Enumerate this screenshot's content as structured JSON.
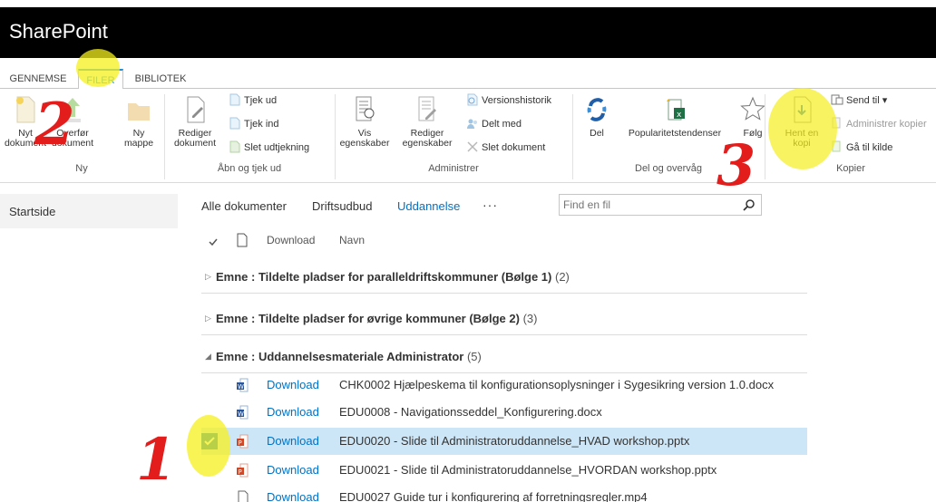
{
  "app": {
    "title": "SharePoint"
  },
  "ribbon_tabs": [
    {
      "label": "GENNEMSE",
      "active": false
    },
    {
      "label": "FILER",
      "active": true
    },
    {
      "label": "BIBLIOTEK",
      "active": false
    }
  ],
  "ribbon": {
    "ny": {
      "label": "Ny",
      "nyt_dokument": "Nyt\ndokument",
      "overfor_dokument": "Overfør\ndokument",
      "ny_mappe": "Ny\nmappe"
    },
    "aabn": {
      "label": "Åbn og tjek ud",
      "rediger_dokument": "Rediger\ndokument",
      "tjek_ud": "Tjek ud",
      "tjek_ind": "Tjek ind",
      "slet_udtjekning": "Slet udtjekning"
    },
    "administrer": {
      "label": "Administrer",
      "vis_egenskaber": "Vis\negenskaber",
      "rediger_egenskaber": "Rediger\negenskaber",
      "versionshistorik": "Versionshistorik",
      "delt_med": "Delt med",
      "slet_dokument": "Slet dokument"
    },
    "del": {
      "label": "Del og overvåg",
      "del": "Del",
      "popularitet": "Popularitetstendenser",
      "folg": "Følg"
    },
    "kopier": {
      "label": "Kopier",
      "hent_kopi": "Hent en\nkopi",
      "send_til": "Send til ▾",
      "administrer_kopier": "Administrer kopier",
      "gaa_til_kilde": "Gå til kilde"
    }
  },
  "leftnav": {
    "startside": "Startside"
  },
  "views": {
    "alle": "Alle dokumenter",
    "drift": "Driftsudbud",
    "uddannelse": "Uddannelse",
    "more": "···"
  },
  "search": {
    "placeholder": "Find en fil"
  },
  "columns": {
    "download": "Download",
    "navn": "Navn"
  },
  "groups": [
    {
      "prefix": "Emne : ",
      "title": "Tildelte pladser for paralleldriftskommuner (Bølge 1)",
      "count": "(2)",
      "expanded": false
    },
    {
      "prefix": "Emne : ",
      "title": "Tildelte pladser for øvrige kommuner (Bølge 2)",
      "count": "(3)",
      "expanded": false
    },
    {
      "prefix": "Emne : ",
      "title": "Uddannelsesmateriale Administrator",
      "count": "(5)",
      "expanded": true
    }
  ],
  "rows": [
    {
      "type": "word",
      "download": "Download",
      "name": "CHK0002 Hjælpeskema til konfigurationsoplysninger i Sygesikring version 1.0.docx",
      "selected": false
    },
    {
      "type": "word",
      "download": "Download",
      "name": "EDU0008 - Navigationsseddel_Konfigurering.docx",
      "selected": false
    },
    {
      "type": "ppt",
      "download": "Download",
      "name": "EDU0020 - Slide til Administratoruddannelse_HVAD workshop.pptx",
      "selected": true
    },
    {
      "type": "ppt",
      "download": "Download",
      "name": "EDU0021 - Slide til Administratoruddannelse_HVORDAN workshop.pptx",
      "selected": false
    },
    {
      "type": "generic",
      "download": "Download",
      "name": "EDU0027 Guide tur i konfigurering af forretningsregler.mp4",
      "selected": false
    }
  ],
  "annotations": {
    "one": "1",
    "two": "2",
    "three": "3"
  },
  "colors": {
    "accent": "#0072c6",
    "tab_accent": "#2a8dd4",
    "selected_row": "#cde6f7",
    "highlight": "#f5f01e",
    "annotation": "#e31c1c"
  }
}
